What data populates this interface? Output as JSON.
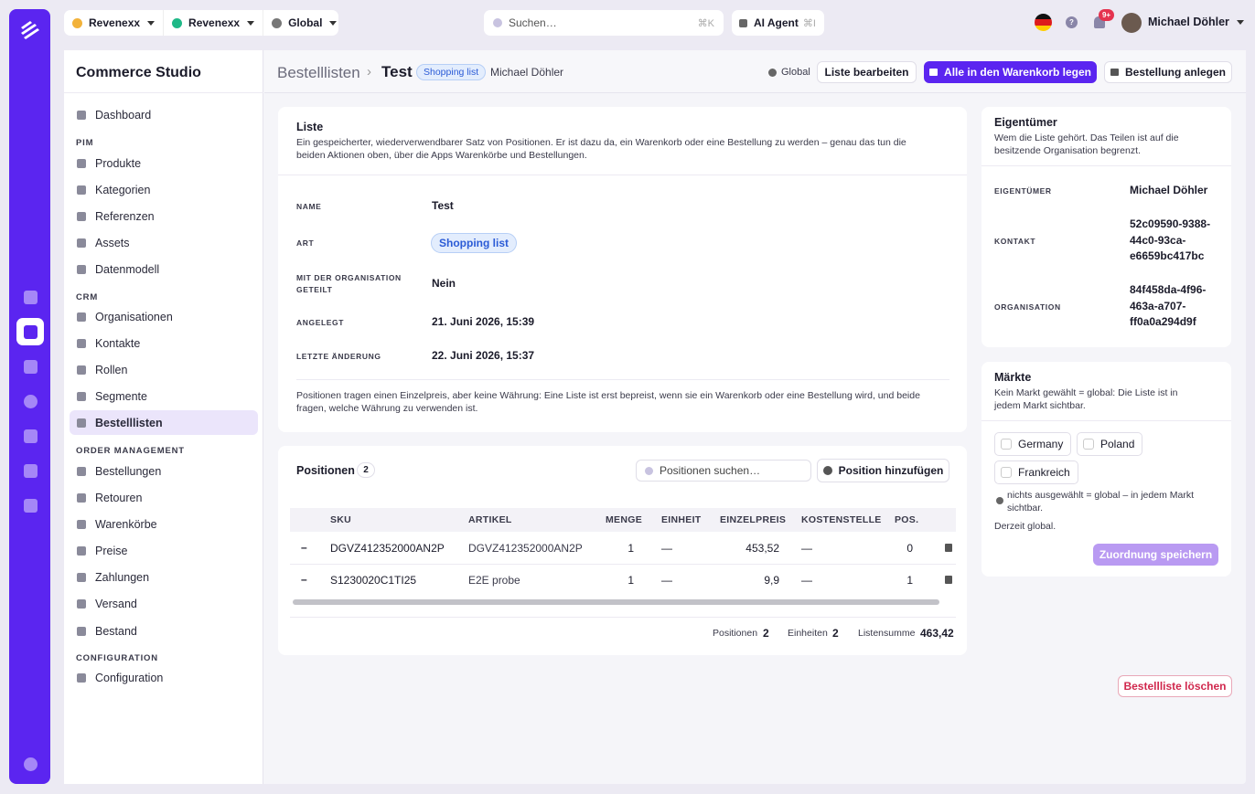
{
  "topbar": {
    "tenant1": "Revenexx",
    "tenant2": "Revenexx",
    "scope": "Global",
    "search_placeholder": "Suchen…",
    "search_shortcut": "⌘K",
    "ai_label": "AI Agent",
    "ai_shortcut": "⌘I",
    "notif_badge": "9+",
    "user_name": "Michael Döhler"
  },
  "sidebar": {
    "title": "Commerce Studio",
    "dashboard": "Dashboard",
    "sections": {
      "pim": "PIM",
      "crm": "CRM",
      "order": "ORDER MANAGEMENT",
      "config": "CONFIGURATION"
    },
    "pim_items": [
      "Produkte",
      "Kategorien",
      "Referenzen",
      "Assets",
      "Datenmodell"
    ],
    "crm_items": [
      "Organisationen",
      "Kontakte",
      "Rollen",
      "Segmente",
      "Bestelllisten"
    ],
    "order_items": [
      "Bestellungen",
      "Retouren",
      "Warenkörbe",
      "Preise",
      "Zahlungen",
      "Versand",
      "Bestand"
    ],
    "config_items": [
      "Configuration"
    ]
  },
  "header": {
    "breadcrumb": "Bestelllisten",
    "title": "Test",
    "tag": "Shopping list",
    "owner": "Michael Döhler",
    "scope": "Global",
    "edit": "Liste bearbeiten",
    "add_all": "Alle in den Warenkorb legen",
    "create_order": "Bestellung anlegen"
  },
  "liste": {
    "title": "Liste",
    "desc": "Ein gespeicherter, wiederverwendbarer Satz von Positionen. Er ist dazu da, ein Warenkorb oder eine Bestellung zu werden – genau das tun die beiden Aktionen oben, über die Apps Warenkörbe und Bestellungen.",
    "fields": [
      {
        "label": "NAME",
        "value": "Test"
      },
      {
        "label": "ART",
        "value": "Shopping list"
      },
      {
        "label": "MIT DER ORGANISATION GETEILT",
        "value": "Nein"
      },
      {
        "label": "ANGELEGT",
        "value": "21. Juni 2026, 15:39"
      },
      {
        "label": "LETZTE ÄNDERUNG",
        "value": "22. Juni 2026, 15:37"
      }
    ],
    "note": "Positionen tragen einen Einzelpreis, aber keine Währung: Eine Liste ist erst bepreist, wenn sie ein Warenkorb oder eine Bestellung wird, und beide fragen, welche Währung zu verwenden ist."
  },
  "positions": {
    "title": "Positionen",
    "count": "2",
    "search_placeholder": "Positionen suchen…",
    "add": "Position hinzufügen",
    "columns": [
      "SKU",
      "ARTIKEL",
      "MENGE",
      "EINHEIT",
      "EINZELPREIS",
      "KOSTENSTELLE",
      "POS."
    ],
    "rows": [
      {
        "sku": "DGVZ412352000AN2P",
        "artikel": "DGVZ412352000AN2P",
        "menge": "1",
        "einheit": "—",
        "preis": "453,52",
        "kst": "—",
        "pos": "0"
      },
      {
        "sku": "S1230020C1TI25",
        "artikel": "E2E probe",
        "menge": "1",
        "einheit": "—",
        "preis": "9,9",
        "kst": "—",
        "pos": "1"
      }
    ],
    "footer": {
      "pos_label": "Positionen",
      "pos_value": "2",
      "units_label": "Einheiten",
      "units_value": "2",
      "sum_label": "Listensumme",
      "sum_value": "463,42"
    }
  },
  "owner": {
    "title": "Eigentümer",
    "desc": "Wem die Liste gehört. Das Teilen ist auf die besitzende Organisation begrenzt.",
    "owner_label": "EIGENTÜMER",
    "owner_value": "Michael Döhler",
    "contact_label": "KONTAKT",
    "contact_l1": "52c09590-9388-",
    "contact_l2": "44c0-93ca-",
    "contact_l3": "e6659bc417bc",
    "org_label": "ORGANISATION",
    "org_l1": "84f458da-4f96-",
    "org_l2": "463a-a707-",
    "org_l3": "ff0a0a294d9f"
  },
  "markets": {
    "title": "Märkte",
    "desc": "Kein Markt gewählt = global: Die Liste ist in jedem Markt sichtbar.",
    "items": [
      "Germany",
      "Poland",
      "Frankreich"
    ],
    "hint": "nichts ausgewählt = global – in jedem Markt sichtbar.",
    "status": "Derzeit global.",
    "save": "Zuordnung speichern"
  },
  "delete_label": "Bestellliste löschen",
  "colors": {
    "accent": "#5b25f0",
    "danger": "#d0284d"
  }
}
